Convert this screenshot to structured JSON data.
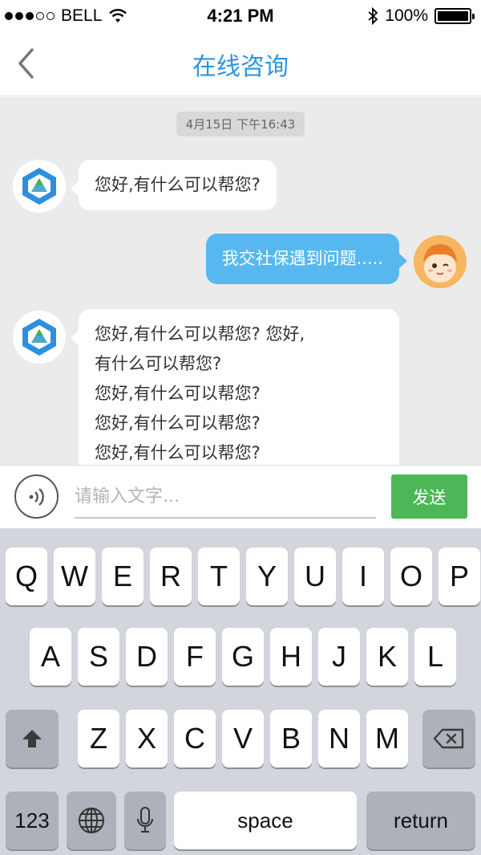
{
  "status_bar": {
    "carrier": "BELL",
    "time": "4:21 PM",
    "battery": "100%",
    "battery_level": 1.0
  },
  "header": {
    "title": "在线咨询",
    "back_icon": "chevron-left-icon"
  },
  "chat": {
    "timestamp": "4月15日 下午16:43",
    "messages": [
      {
        "sender": "agent",
        "avatar_icon": "logo-icon",
        "lines": [
          "您好,有什么可以帮您?"
        ]
      },
      {
        "sender": "user",
        "avatar_icon": "user-avatar-icon",
        "lines": [
          "我交社保遇到问题....."
        ]
      },
      {
        "sender": "agent",
        "avatar_icon": "logo-icon",
        "lines": [
          "您好,有什么可以帮您?  您好,",
          "有什么可以帮您?",
          "您好,有什么可以帮您?",
          "您好,有什么可以帮您?",
          "您好,有什么可以帮您?"
        ]
      }
    ]
  },
  "input_bar": {
    "placeholder": "请输入文字...",
    "send_label": "发送",
    "voice_icon": "voice-icon"
  },
  "keyboard": {
    "row1": [
      "Q",
      "W",
      "E",
      "R",
      "T",
      "Y",
      "U",
      "I",
      "O",
      "P"
    ],
    "row2": [
      "A",
      "S",
      "D",
      "F",
      "G",
      "H",
      "J",
      "K",
      "L"
    ],
    "row3": [
      "Z",
      "X",
      "C",
      "V",
      "B",
      "N",
      "M"
    ],
    "numbers_label": "123",
    "space_label": "space",
    "return_label": "return"
  }
}
